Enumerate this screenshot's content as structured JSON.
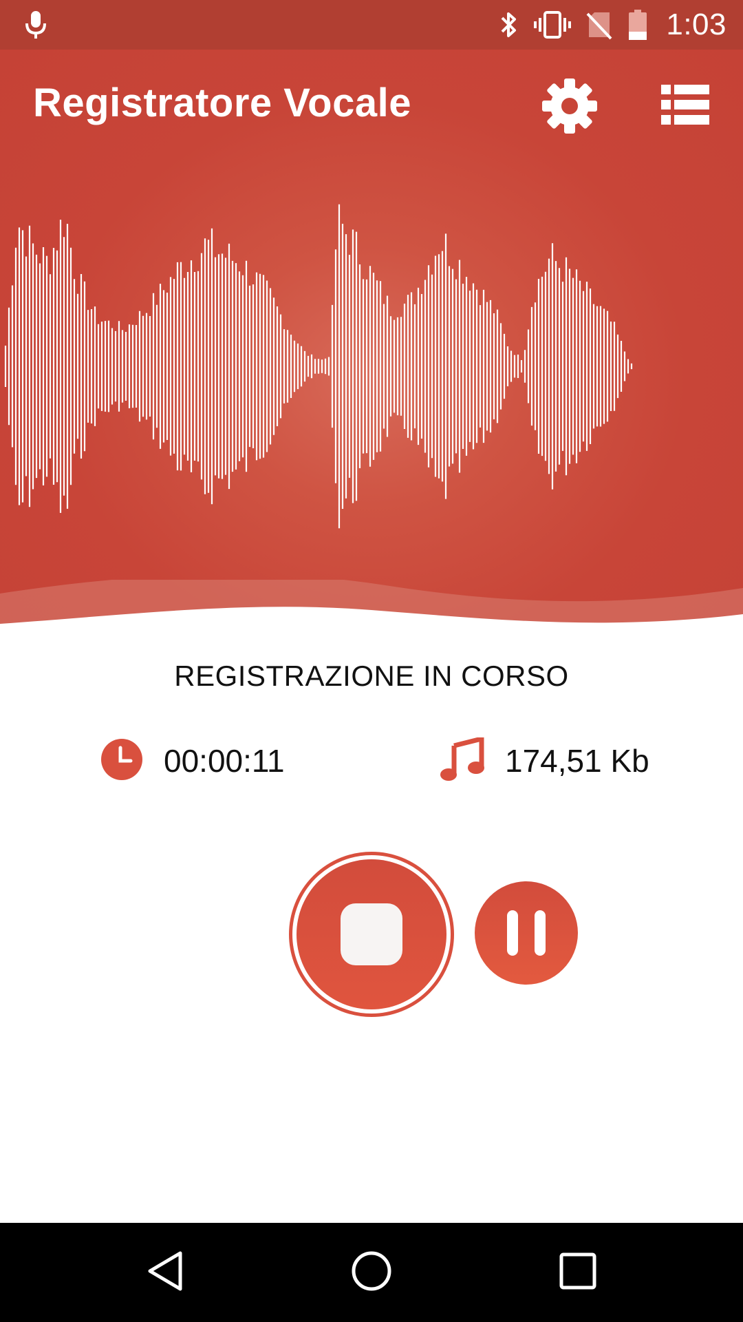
{
  "status_bar": {
    "time": "1:03",
    "icons": [
      "mic-icon",
      "bluetooth-icon",
      "vibrate-icon",
      "no-sim-icon",
      "battery-icon"
    ]
  },
  "app": {
    "title": "Registratore Vocale",
    "actions": [
      "settings-icon",
      "list-icon"
    ]
  },
  "recording": {
    "status": "REGISTRAZIONE IN CORSO",
    "elapsed": "00:00:11",
    "file_size": "174,51 Kb"
  },
  "controls": [
    "stop-button",
    "pause-button"
  ],
  "navigation": [
    "back-icon",
    "home-icon",
    "recents-icon"
  ],
  "colors": {
    "accent": "#d9503e",
    "status_bar": "#b13f32",
    "header": "#c84538"
  }
}
